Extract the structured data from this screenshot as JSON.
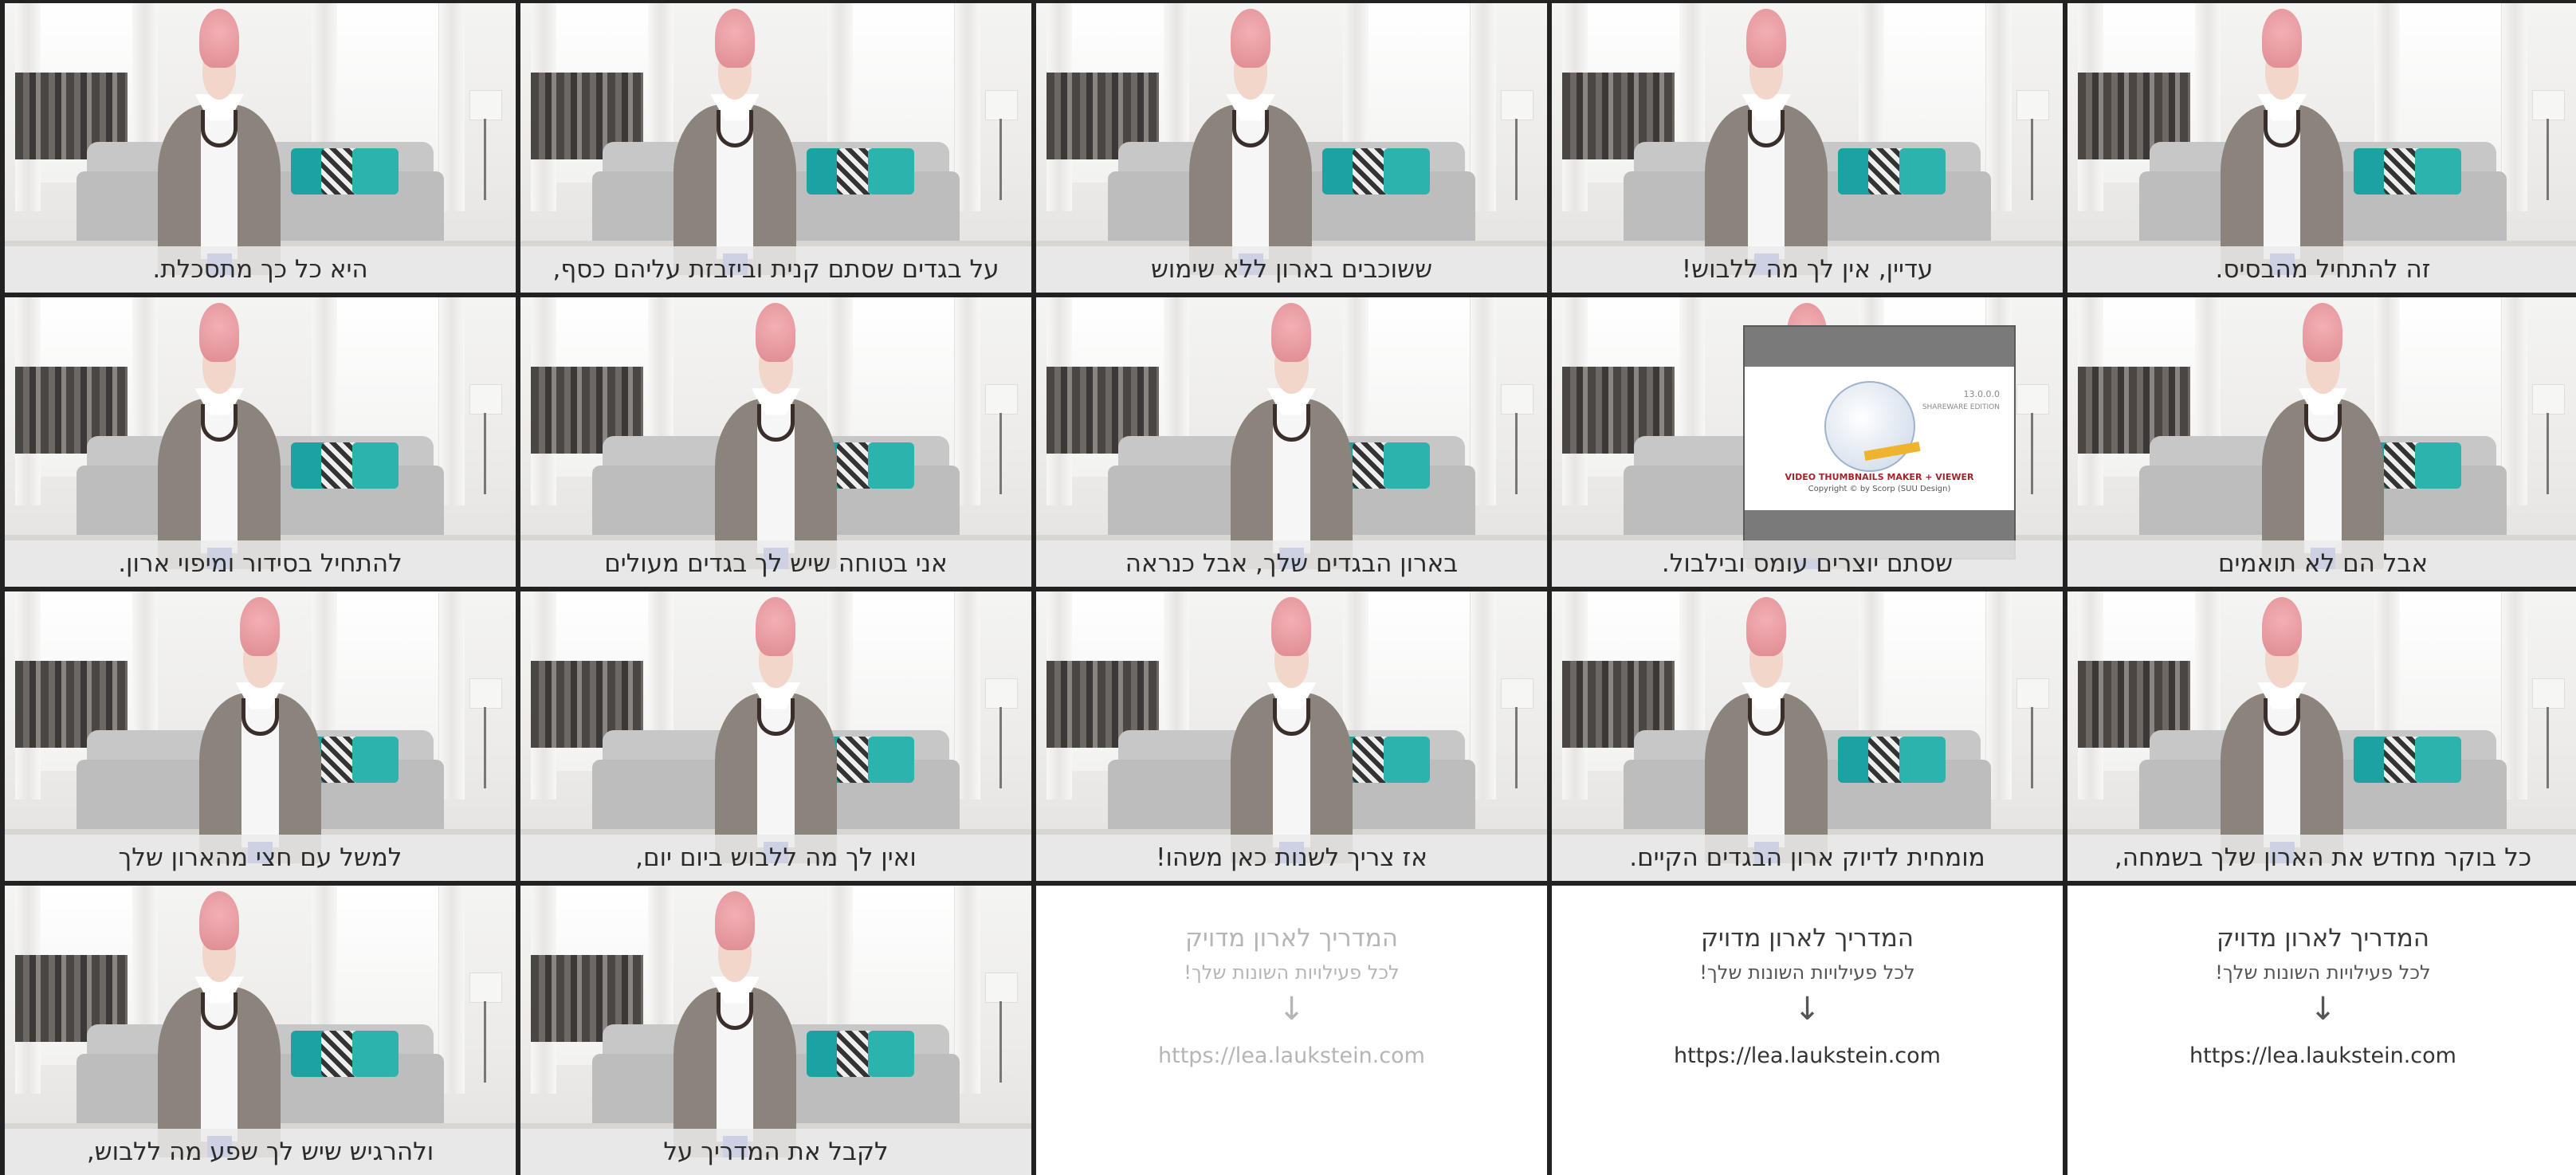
{
  "thumbnails": [
    {
      "caption": "היא כל כך מתסכלת."
    },
    {
      "caption": "על בגדים שסתם קנית וביזבזת עליהם כסף,"
    },
    {
      "caption": "ששוכבים בארון ללא שימוש"
    },
    {
      "caption": "עדיין, אין לך מה ללבוש!"
    },
    {
      "caption": "זה להתחיל מהבסיס."
    },
    {
      "caption": "להתחיל בסידור ומיפוי ארון."
    },
    {
      "caption": "אני בטוחה שיש לך בגדים מעולים"
    },
    {
      "caption": "בארון הבגדים שלך, אבל כנראה"
    },
    {
      "caption": "שסתם יוצרים עומס ובילבול."
    },
    {
      "caption": "אבל הם לא תואמים"
    },
    {
      "caption": "למשל עם חצי מהארון שלך"
    },
    {
      "caption": "ואין לך מה ללבוש ביום יום,"
    },
    {
      "caption": "אז צריך לשנות כאן משהו!"
    },
    {
      "caption": "מומחית לדיוק ארון הבגדים הקיים."
    },
    {
      "caption": "כל בוקר מחדש את הארון שלך בשמחה,"
    },
    {
      "caption": "ולהרגיש שיש לך שפע מה ללבוש,"
    },
    {
      "caption": "לקבל את המדריך על"
    }
  ],
  "splash": {
    "version": "13.0.0.0",
    "edition": "SHAREWARE EDITION",
    "brand": "VIDEO THUMBNAILS MAKER + VIEWER",
    "copyright": "Copyright © by Scorp (SUU Design)"
  },
  "endcard": {
    "title": "המדריך לארון מדויק",
    "subtitle": "לכל פעילויות השונות שלך!",
    "arrow": "↓",
    "url": "https://lea.laukstein.com"
  }
}
